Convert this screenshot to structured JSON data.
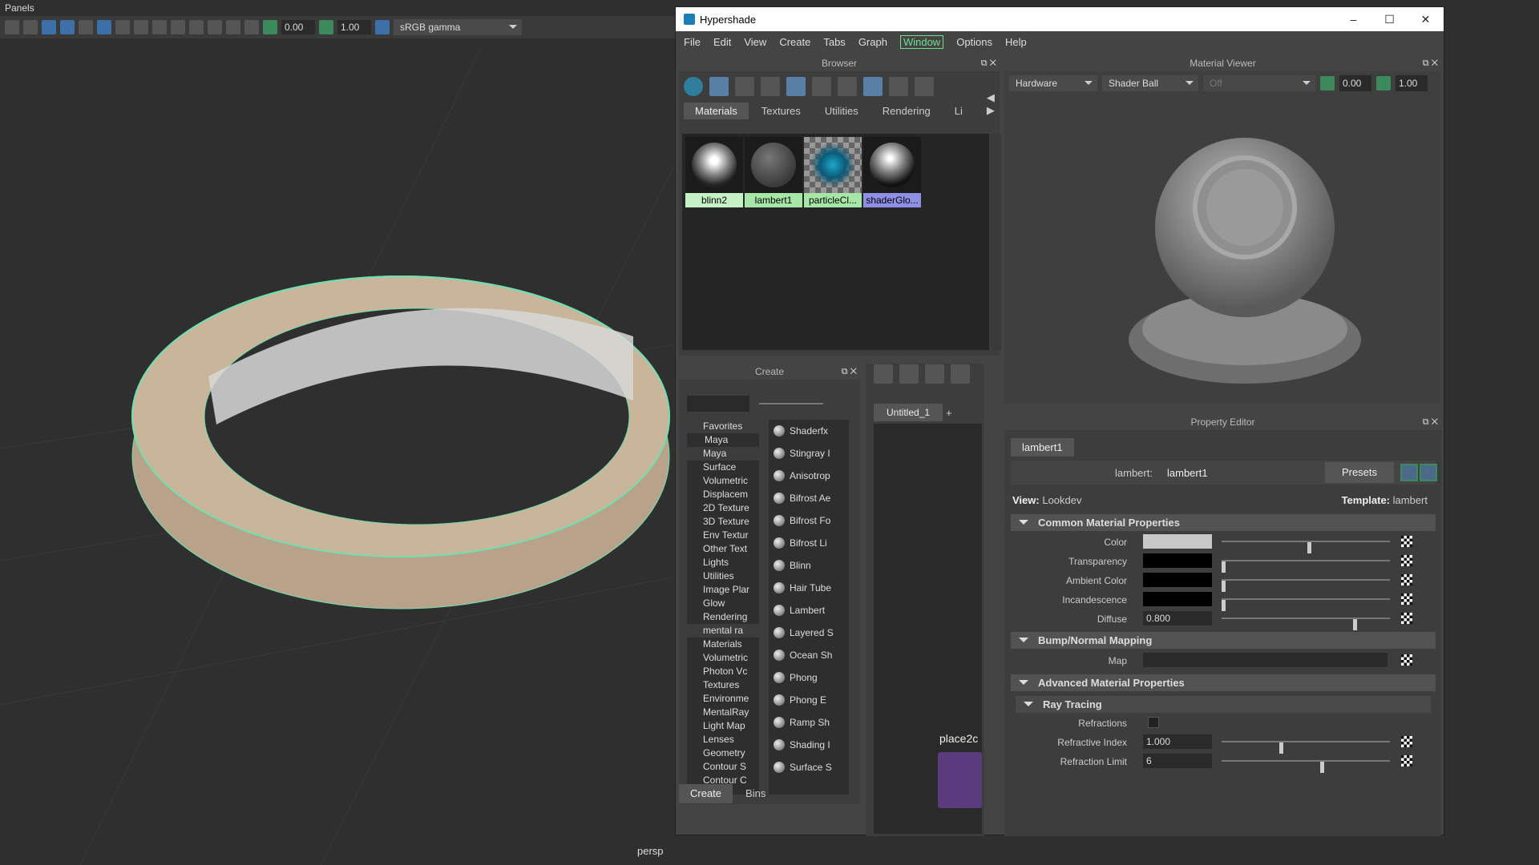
{
  "viewport": {
    "panels_label": "Panels",
    "exposure": "0.00",
    "gamma": "1.00",
    "colorspace": "sRGB gamma",
    "camera_label": "persp"
  },
  "hypershade": {
    "title": "Hypershade",
    "menu": [
      "File",
      "Edit",
      "View",
      "Create",
      "Tabs",
      "Graph",
      "Window",
      "Options",
      "Help"
    ],
    "browser": {
      "title": "Browser",
      "tabs": [
        "Materials",
        "Textures",
        "Utilities",
        "Rendering",
        "Li"
      ],
      "swatches": [
        {
          "label": "blinn2",
          "color": "#c6f0c6"
        },
        {
          "label": "lambert1",
          "color": "#a6e6a6"
        },
        {
          "label": "particleCl...",
          "color": "#a6e6a6"
        },
        {
          "label": "shaderGlo...",
          "color": "#8f8fe6"
        }
      ]
    },
    "create": {
      "title": "Create",
      "tree": [
        {
          "t": "Favorites",
          "k": "hdr"
        },
        {
          "t": "Maya",
          "k": "sub"
        },
        {
          "t": "Maya",
          "k": "hdr"
        },
        {
          "t": "Surface",
          "k": "item"
        },
        {
          "t": "Volumetric",
          "k": "item"
        },
        {
          "t": "Displacem",
          "k": "item"
        },
        {
          "t": "2D Texture",
          "k": "item"
        },
        {
          "t": "3D Texture",
          "k": "item"
        },
        {
          "t": "Env Textur",
          "k": "item"
        },
        {
          "t": "Other Text",
          "k": "item"
        },
        {
          "t": "Lights",
          "k": "item"
        },
        {
          "t": "Utilities",
          "k": "item"
        },
        {
          "t": "Image Plar",
          "k": "item"
        },
        {
          "t": "Glow",
          "k": "item"
        },
        {
          "t": "Rendering",
          "k": "item"
        },
        {
          "t": "mental ra",
          "k": "hdr"
        },
        {
          "t": "Materials",
          "k": "item"
        },
        {
          "t": "Volumetric",
          "k": "item"
        },
        {
          "t": "Photon Vc",
          "k": "item"
        },
        {
          "t": "Textures",
          "k": "item"
        },
        {
          "t": "Environme",
          "k": "item"
        },
        {
          "t": "MentalRay",
          "k": "item"
        },
        {
          "t": "Light Map",
          "k": "item"
        },
        {
          "t": "Lenses",
          "k": "item"
        },
        {
          "t": "Geometry",
          "k": "item"
        },
        {
          "t": "Contour S",
          "k": "item"
        },
        {
          "t": "Contour C",
          "k": "item"
        }
      ],
      "nodes": [
        "Shaderfx",
        "Stingray I",
        "Anisotrop",
        "Bifrost Ae",
        "Bifrost Fo",
        "Bifrost Li",
        "Blinn",
        "Hair Tube",
        "Lambert",
        "Layered S",
        "Ocean Sh",
        "Phong",
        "Phong E",
        "Ramp Sh",
        "Shading I",
        "Surface S"
      ],
      "bottom_tabs": [
        "Create",
        "Bins"
      ]
    },
    "graph": {
      "tab": "Untitled_1",
      "plus": "+",
      "node_label": "place2c"
    },
    "material_viewer": {
      "title": "Material Viewer",
      "renderer": "Hardware",
      "shape": "Shader Ball",
      "env": "Off",
      "exposure": "0.00",
      "gamma": "1.00"
    },
    "property_editor": {
      "title": "Property Editor",
      "tab": "lambert1",
      "node_type_label": "lambert:",
      "node_name": "lambert1",
      "presets": "Presets",
      "view_label": "View:",
      "view_value": "Lookdev",
      "template_label": "Template:",
      "template_value": "lambert",
      "sections": {
        "common": "Common Material Properties",
        "bump": "Bump/Normal Mapping",
        "advanced": "Advanced Material Properties",
        "raytracing": "Ray Tracing"
      },
      "attrs": {
        "color": {
          "label": "Color",
          "swatch": "#c8c8c8",
          "level": 0.52
        },
        "transparency": {
          "label": "Transparency",
          "swatch": "#000000",
          "level": 0.0
        },
        "ambient": {
          "label": "Ambient Color",
          "swatch": "#000000",
          "level": 0.0
        },
        "incandescence": {
          "label": "Incandescence",
          "swatch": "#000000",
          "level": 0.0
        },
        "diffuse": {
          "label": "Diffuse",
          "value": "0.800",
          "level": 0.8
        },
        "map": {
          "label": "Map"
        },
        "refractions": {
          "label": "Refractions"
        },
        "refractive_index": {
          "label": "Refractive Index",
          "value": "1.000",
          "level": 0.35
        },
        "refraction_limit": {
          "label": "Refraction Limit",
          "value": "6",
          "level": 0.6
        }
      }
    }
  }
}
